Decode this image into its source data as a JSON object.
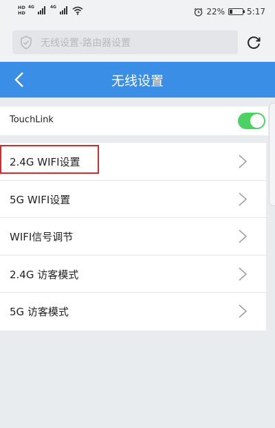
{
  "status_bar": {
    "hd_top": "HD",
    "hd_bottom": "HD",
    "net_1": "4G",
    "net_2": "4G",
    "battery_percent": "22%",
    "battery_level": 0.22,
    "time": "5:17"
  },
  "search": {
    "placeholder": "无线设置-路由器设置"
  },
  "header": {
    "title": "无线设置"
  },
  "touchlink": {
    "label": "TouchLink",
    "enabled": true
  },
  "menu": {
    "items": [
      {
        "label": "2.4G WIFI设置"
      },
      {
        "label": "5G WIFI设置"
      },
      {
        "label": "WIFI信号调节"
      },
      {
        "label": "2.4G 访客模式"
      },
      {
        "label": "5G 访客模式"
      }
    ]
  },
  "colors": {
    "accent": "#3a8ee6",
    "toggle_on": "#4cd263",
    "highlight": "#d8262a"
  },
  "icons": {
    "search_bar": "shield-check-icon",
    "reload": "reload-icon",
    "back": "chevron-left-icon",
    "row": "chevron-right-icon"
  }
}
